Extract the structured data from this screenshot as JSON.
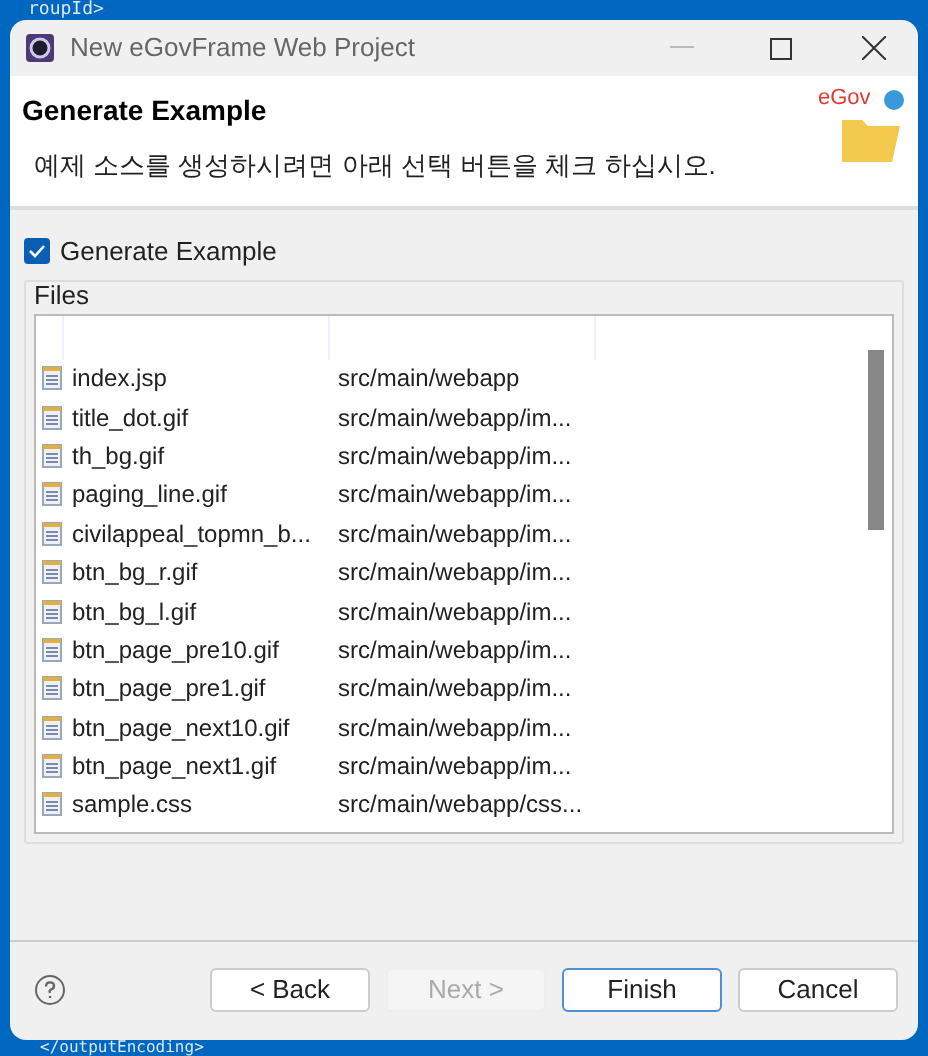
{
  "background_text": [
    "roupId>",
    "</outputEncoding>"
  ],
  "window": {
    "title": "New eGovFrame Web Project"
  },
  "header": {
    "title": "Generate Example",
    "description": "예제 소스를 생성하시려면 아래 선택 버튼을 체크 하십시오.",
    "logo_text": "eGov"
  },
  "generate_checkbox": {
    "label": "Generate Example",
    "checked": true
  },
  "files": {
    "group_label": "Files",
    "rows": [
      {
        "name": "index.jsp",
        "path": "src/main/webapp"
      },
      {
        "name": "title_dot.gif",
        "path": "src/main/webapp/im..."
      },
      {
        "name": "th_bg.gif",
        "path": "src/main/webapp/im..."
      },
      {
        "name": "paging_line.gif",
        "path": "src/main/webapp/im..."
      },
      {
        "name": "civilappeal_topmn_b...",
        "path": "src/main/webapp/im..."
      },
      {
        "name": "btn_bg_r.gif",
        "path": "src/main/webapp/im..."
      },
      {
        "name": "btn_bg_l.gif",
        "path": "src/main/webapp/im..."
      },
      {
        "name": "btn_page_pre10.gif",
        "path": "src/main/webapp/im..."
      },
      {
        "name": "btn_page_pre1.gif",
        "path": "src/main/webapp/im..."
      },
      {
        "name": "btn_page_next10.gif",
        "path": "src/main/webapp/im..."
      },
      {
        "name": "btn_page_next1.gif",
        "path": "src/main/webapp/im..."
      },
      {
        "name": "sample.css",
        "path": "src/main/webapp/css..."
      }
    ]
  },
  "buttons": [
    {
      "label": "< Back",
      "disabled": false,
      "default": false
    },
    {
      "label": "Next >",
      "disabled": true,
      "default": false
    },
    {
      "label": "Finish",
      "disabled": false,
      "default": true
    },
    {
      "label": "Cancel",
      "disabled": false,
      "default": false
    }
  ]
}
